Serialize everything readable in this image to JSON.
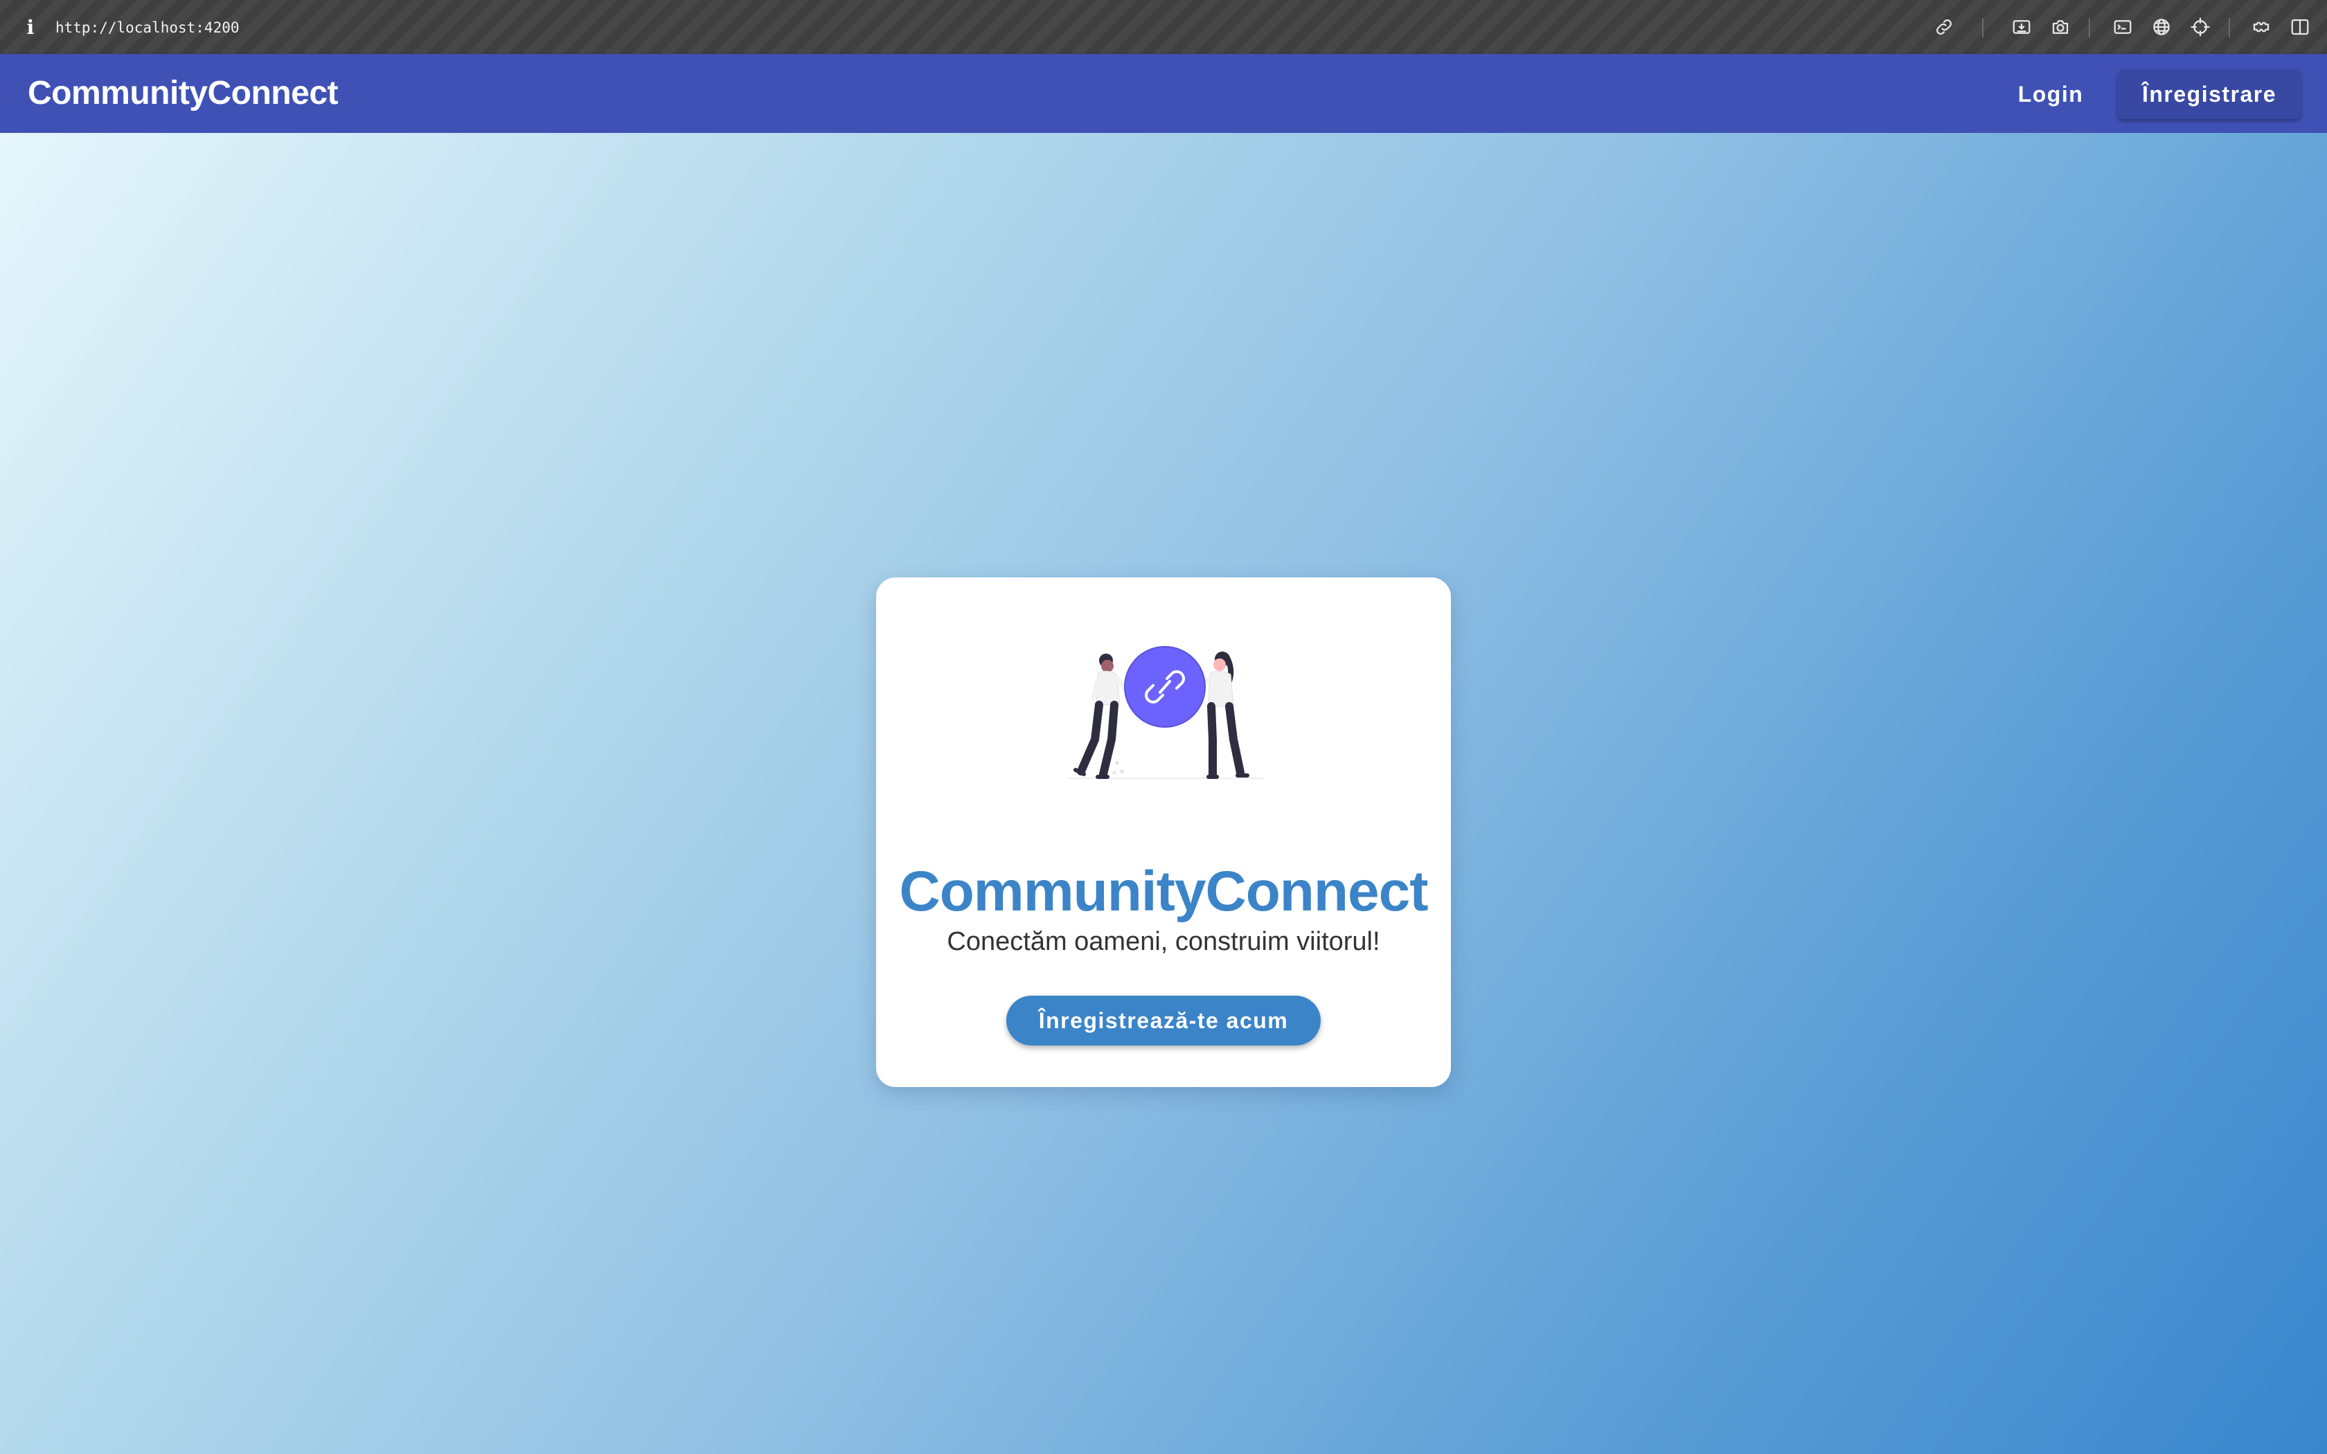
{
  "browser": {
    "info_glyph": "i",
    "url": "http://localhost:4200",
    "tools": [
      "link-icon",
      "save-page-icon",
      "camera-icon",
      "terminal-icon",
      "globe-icon",
      "crosshair-icon",
      "extensions-icon",
      "split-view-icon"
    ]
  },
  "appbar": {
    "brand": "CommunityConnect",
    "login_label": "Login",
    "register_label": "Înregistrare",
    "color": "#3f51b5"
  },
  "hero": {
    "title": "CommunityConnect",
    "subtitle": "Conectăm oameni, construim viitorul!",
    "cta_label": "Înregistrează-te acum",
    "accent": "#3b84c8",
    "illustration_accent": "#6c63ff"
  }
}
